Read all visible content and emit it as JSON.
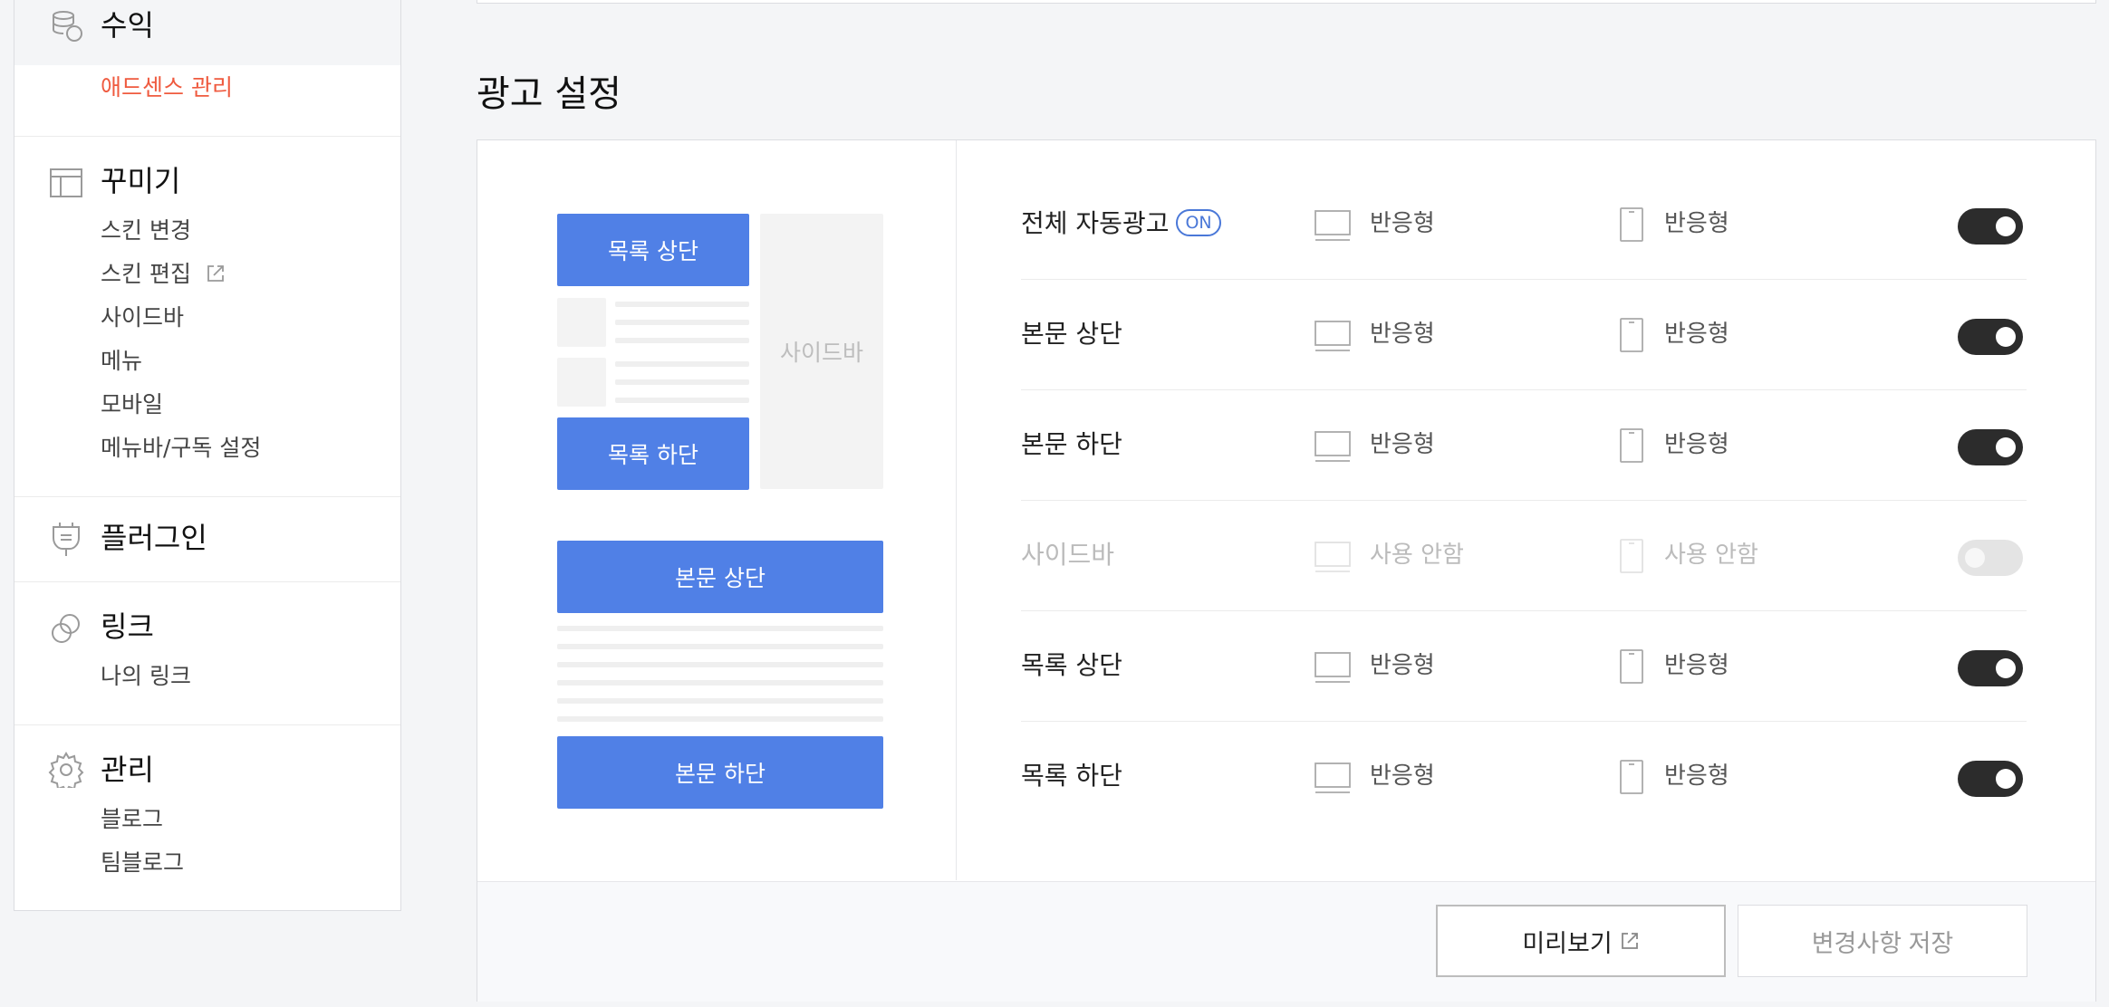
{
  "sidebar": {
    "revenue": {
      "title": "수익",
      "items": [
        {
          "label": "애드센스 관리",
          "active": true
        }
      ]
    },
    "decorate": {
      "title": "꾸미기",
      "items": [
        {
          "label": "스킨 변경"
        },
        {
          "label": "스킨 편집"
        },
        {
          "label": "사이드바"
        },
        {
          "label": "메뉴"
        },
        {
          "label": "모바일"
        },
        {
          "label": "메뉴바/구독 설정"
        }
      ]
    },
    "plugin": {
      "title": "플러그인"
    },
    "link": {
      "title": "링크",
      "items": [
        {
          "label": "나의 링크"
        }
      ]
    },
    "manage": {
      "title": "관리",
      "items": [
        {
          "label": "블로그"
        },
        {
          "label": "팀블로그"
        }
      ]
    }
  },
  "page": {
    "title": "광고 설정"
  },
  "preview": {
    "list_top": "목록 상단",
    "sidebar": "사이드바",
    "list_bottom": "목록 하단",
    "body_top": "본문 상단",
    "body_bottom": "본문 하단"
  },
  "settings": {
    "rows": [
      {
        "label": "전체 자동광고",
        "badge": "ON",
        "pc": "반응형",
        "mobile": "반응형",
        "enabled": true
      },
      {
        "label": "본문 상단",
        "pc": "반응형",
        "mobile": "반응형",
        "enabled": true
      },
      {
        "label": "본문 하단",
        "pc": "반응형",
        "mobile": "반응형",
        "enabled": true
      },
      {
        "label": "사이드바",
        "pc": "사용 안함",
        "mobile": "사용 안함",
        "enabled": false
      },
      {
        "label": "목록 상단",
        "pc": "반응형",
        "mobile": "반응형",
        "enabled": true
      },
      {
        "label": "목록 하단",
        "pc": "반응형",
        "mobile": "반응형",
        "enabled": true
      }
    ]
  },
  "footer": {
    "preview_button": "미리보기",
    "save_button": "변경사항 저장"
  },
  "colors": {
    "accent_blue": "#5080e6",
    "active_red": "#ef5a3f",
    "toggle_on": "#2c2c2c",
    "toggle_off": "#e4e4e4"
  }
}
